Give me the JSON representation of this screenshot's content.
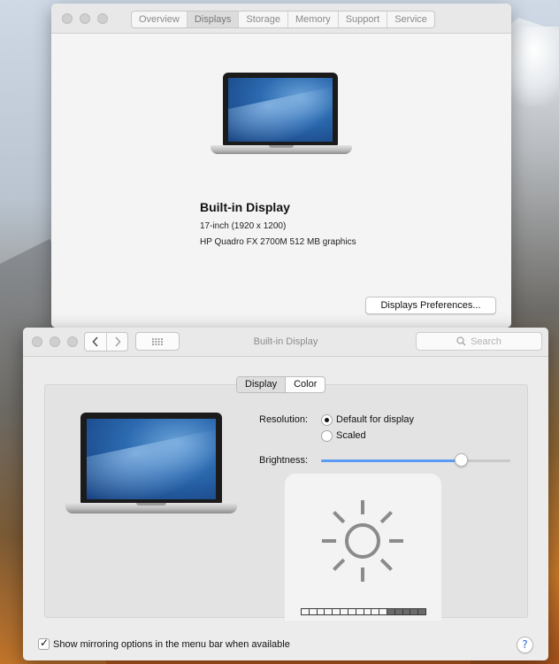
{
  "about_window": {
    "tabs": [
      {
        "label": "Overview"
      },
      {
        "label": "Displays",
        "active": true
      },
      {
        "label": "Storage"
      },
      {
        "label": "Memory"
      },
      {
        "label": "Support"
      },
      {
        "label": "Service"
      }
    ],
    "display_name": "Built-in Display",
    "display_size": "17-inch (1920 x 1200)",
    "graphics": "HP Quadro FX 2700M 512 MB graphics",
    "prefs_button_label": "Displays Preferences..."
  },
  "display_prefs": {
    "title": "Built-in Display",
    "search_placeholder": "Search",
    "tabs": [
      {
        "label": "Display",
        "active": true
      },
      {
        "label": "Color"
      }
    ],
    "resolution_label": "Resolution:",
    "resolution_options": [
      {
        "label": "Default for display",
        "selected": true
      },
      {
        "label": "Scaled",
        "selected": false
      }
    ],
    "brightness_label": "Brightness:",
    "brightness_level": 0.74,
    "hud_level_segments": {
      "on": 11,
      "total": 16
    },
    "mirroring_checkbox": {
      "checked": true,
      "label": "Show mirroring options in the menu bar when available"
    },
    "help_label": "?"
  },
  "icons": [
    "back-chevron-icon",
    "forward-chevron-icon",
    "grid-icon",
    "search-icon",
    "brightness-sun-icon",
    "help-icon"
  ],
  "colors": {
    "accent": "#5b9bf3",
    "help_blue": "#2f6fd9"
  }
}
